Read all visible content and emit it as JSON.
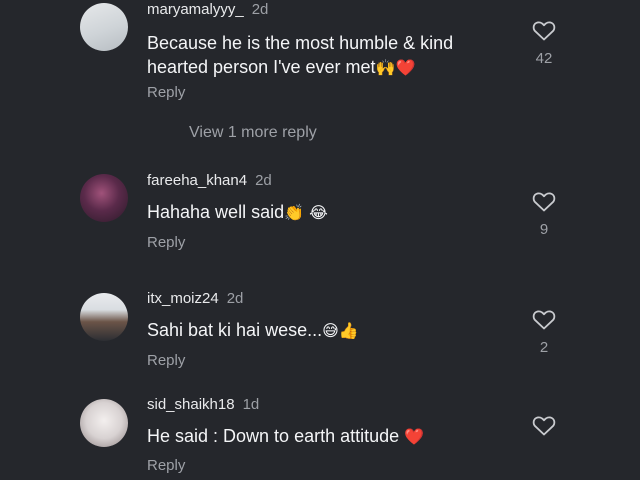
{
  "comments": [
    {
      "username": "maryamalyyy_",
      "time": "2d",
      "text_line1": "Because he is the most humble & kind",
      "text_line2": "hearted person I've ever met",
      "emoji": "🙌❤️",
      "reply": "Reply",
      "likes": "42"
    },
    {
      "username": "fareeha_khan4",
      "time": "2d",
      "text": "Hahaha well said",
      "emoji": "👏 😂",
      "reply": "Reply",
      "likes": "9"
    },
    {
      "username": "itx_moiz24",
      "time": "2d",
      "text": "Sahi bat ki hai wese...",
      "emoji": "😅👍",
      "reply": "Reply",
      "likes": "2"
    },
    {
      "username": "sid_shaikh18",
      "time": "1d",
      "text": "He said : Down to earth attitude",
      "emoji": "❤️",
      "reply": "Reply",
      "likes": ""
    }
  ],
  "view_more_label": "View 1 more reply",
  "icons": {
    "like": "heart-outline-icon"
  },
  "colors": {
    "background": "#25272c",
    "secondary_text": "#9ea1a7",
    "heart": "#e8243c"
  }
}
